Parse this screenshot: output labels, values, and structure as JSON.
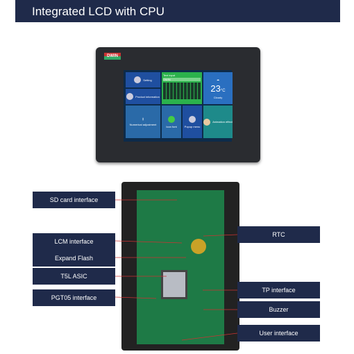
{
  "banner": {
    "title": "Integrated LCD with CPU"
  },
  "device": {
    "logo": "DWIN",
    "screen": {
      "setting": "Setting",
      "product_info": "Product information",
      "text_input": "Text input",
      "input_value": "DWIN",
      "temperature": "23",
      "temp_unit": "°C",
      "weather": "Cloudy",
      "numerical": "Numerical adjustment",
      "icon_font": "Icon font",
      "popup": "Popup menu",
      "animation": "Animation effect"
    }
  },
  "labels": {
    "sd": "SD card interface",
    "lcm": "LCM interface",
    "flash": "Expand Flash",
    "asic": "T5L ASIC",
    "pgt": "PGT05 interface",
    "rtc": "RTC",
    "tp": "TP interface",
    "buzzer": "Buzzer",
    "user": "User interface"
  },
  "colors": {
    "label_bg": "#1f2a4a",
    "pcb": "#1e7a46"
  }
}
